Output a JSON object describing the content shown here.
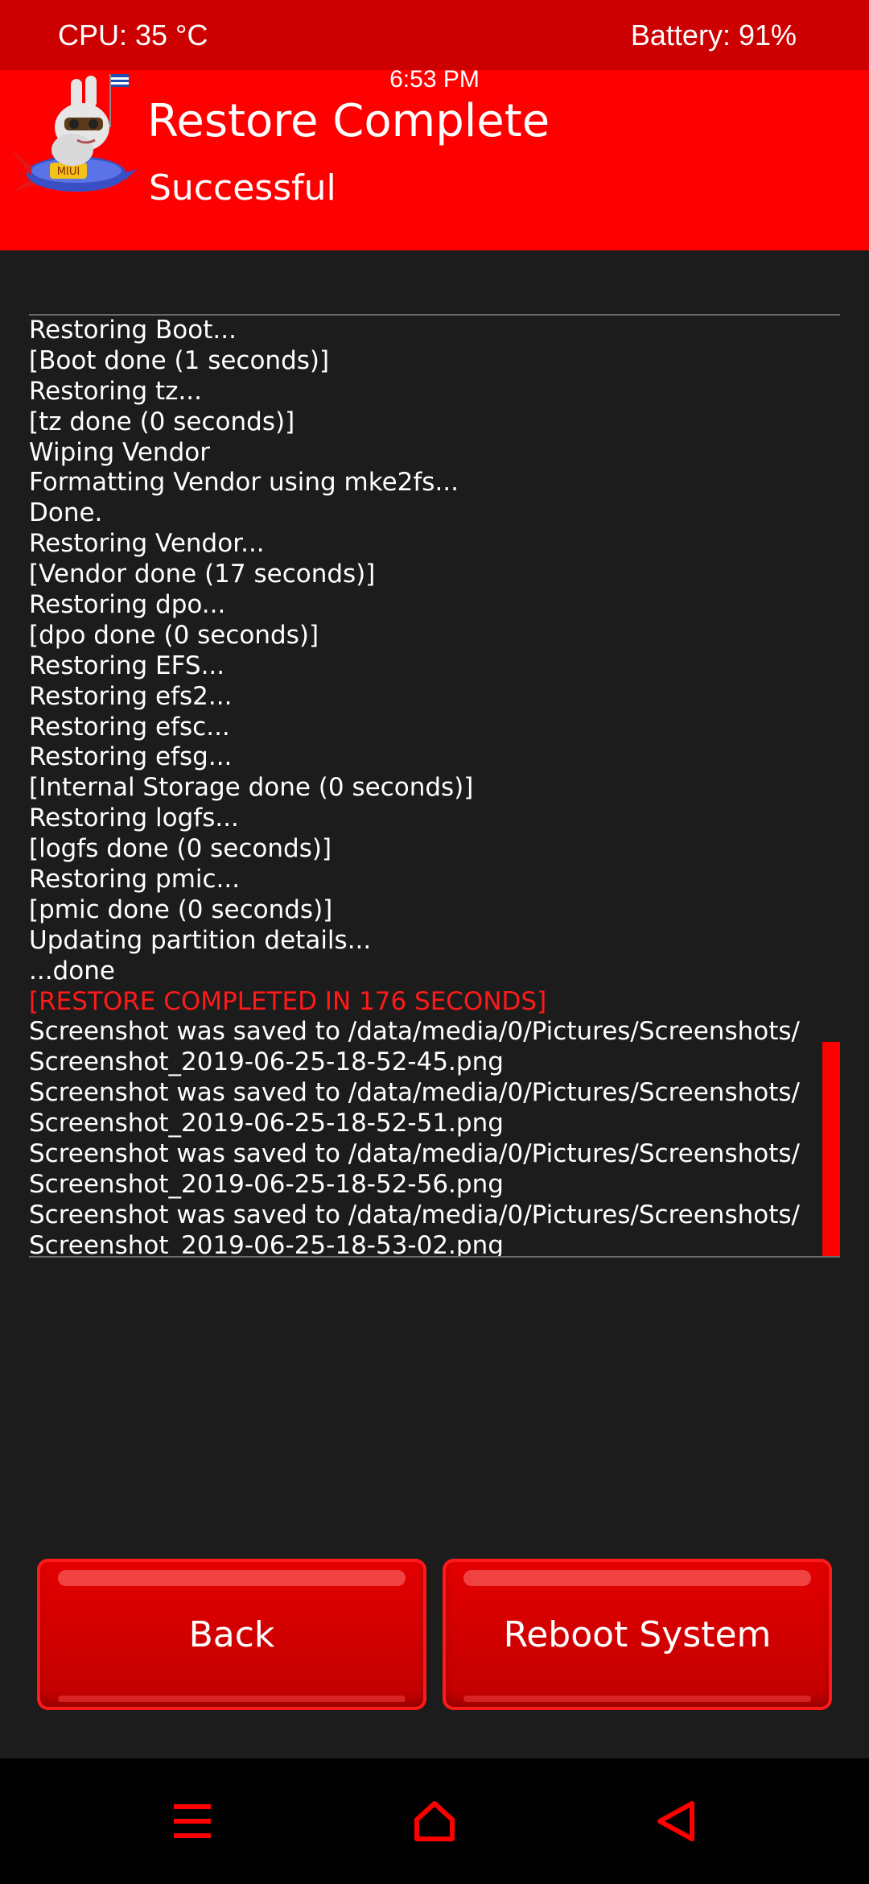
{
  "status_bar": {
    "cpu": "CPU: 35 °C",
    "battery": "Battery: 91%"
  },
  "header": {
    "time": "6:53 PM",
    "title": "Restore Complete",
    "subtitle": "Successful",
    "mascot_badge": "MIUI",
    "accent_color": "#ff0000",
    "status_color": "#cc0000"
  },
  "console": {
    "lines": [
      "Restoring Boot...",
      "[Boot done (1 seconds)]",
      "Restoring tz...",
      "[tz done (0 seconds)]",
      "Wiping Vendor",
      "Formatting Vendor using mke2fs...",
      "Done.",
      "Restoring Vendor...",
      "[Vendor done (17 seconds)]",
      "Restoring dpo...",
      "[dpo done (0 seconds)]",
      "Restoring EFS...",
      "Restoring efs2...",
      "Restoring efsc...",
      "Restoring efsg...",
      "[Internal Storage done (0 seconds)]",
      "Restoring logfs...",
      "[logfs done (0 seconds)]",
      "Restoring pmic...",
      "[pmic done (0 seconds)]",
      "Updating partition details...",
      "...done",
      "[RESTORE COMPLETED IN 176 SECONDS]",
      "Screenshot was saved to /data/media/0/Pictures/Screenshots/",
      "Screenshot_2019-06-25-18-52-45.png",
      "Screenshot was saved to /data/media/0/Pictures/Screenshots/",
      "Screenshot_2019-06-25-18-52-51.png",
      "Screenshot was saved to /data/media/0/Pictures/Screenshots/",
      "Screenshot_2019-06-25-18-52-56.png",
      "Screenshot was saved to /data/media/0/Pictures/Screenshots/",
      "Screenshot_2019-06-25-18-53-02.png"
    ],
    "highlight_color": "#ff1a1a"
  },
  "buttons": {
    "back_label": "Back",
    "reboot_label": "Reboot System"
  },
  "navbar": {
    "icons": [
      "menu-icon",
      "home-icon",
      "back-icon"
    ],
    "icon_color": "#ff0000"
  }
}
